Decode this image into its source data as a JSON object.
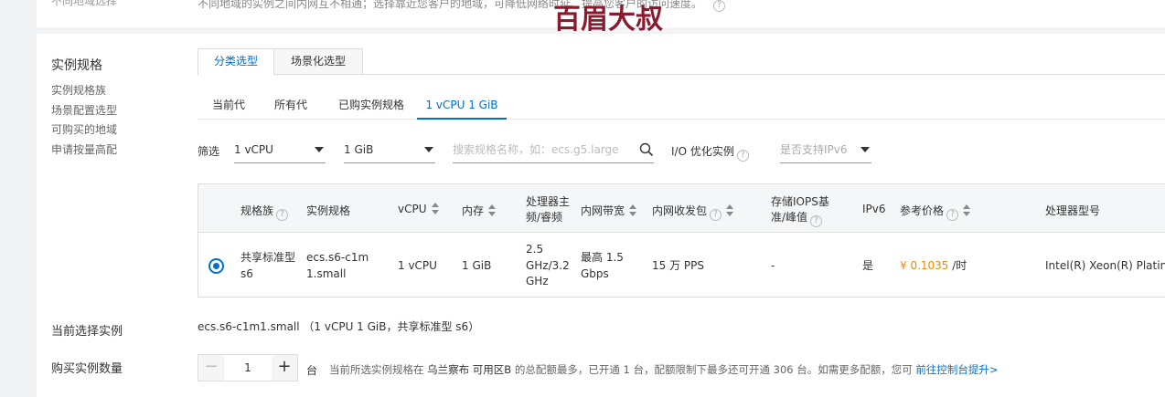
{
  "region": {
    "label": "不同地域选择",
    "note": "不同地域的实例之间内网互不相通；选择靠近您客户的地域，可降低网络时延、提高您客户的访问速度。"
  },
  "watermark": "百眉大叔",
  "sidebar": {
    "title": "实例规格",
    "links": [
      "实例规格族",
      "场景配置选型",
      "可购买的地域",
      "申请按量高配"
    ]
  },
  "tabs": [
    {
      "label": "分类选型",
      "active": true
    },
    {
      "label": "场景化选型",
      "active": false
    }
  ],
  "subtabs": [
    {
      "label": "当前代",
      "active": false
    },
    {
      "label": "所有代",
      "active": false
    },
    {
      "label": "已购实例规格",
      "active": false
    },
    {
      "label": "1 vCPU 1 GiB",
      "active": true
    }
  ],
  "filter": {
    "label": "筛选",
    "vcpu": "1 vCPU",
    "memory": "1 GiB",
    "search_placeholder": "搜索规格名称，如：ecs.g5.large",
    "io_label": "I/O 优化实例",
    "ipv6_placeholder": "是否支持IPv6"
  },
  "table": {
    "headers": {
      "family": "规格族",
      "spec": "实例规格",
      "vcpu": "vCPU",
      "memory": "内存",
      "freq": "处理器主频/睿频",
      "bandwidth": "内网带宽",
      "pps": "内网收发包",
      "iops": "存储IOPS基准/峰值",
      "ipv6": "IPv6",
      "price": "参考价格",
      "cpu_model": "处理器型号"
    },
    "row": {
      "family": "共享标准型 s6",
      "spec": "ecs.s6-c1m1.small",
      "vcpu": "1 vCPU",
      "memory": "1 GiB",
      "freq": "2.5 GHz/3.2 GHz",
      "bandwidth": "最高 1.5 Gbps",
      "pps": "15 万 PPS",
      "iops": "-",
      "ipv6": "是",
      "price": "¥ 0.1035",
      "price_unit": "/时",
      "cpu_model": "Intel(R) Xeon(R) Platinum"
    }
  },
  "current": {
    "label": "当前选择实例",
    "value": "ecs.s6-c1m1.small （1 vCPU 1 GiB，共享标准型 s6）"
  },
  "quantity": {
    "label": "购买实例数量",
    "minus": "−",
    "plus": "+",
    "value": "1",
    "unit": "台",
    "quota_prefix": "当前所选实例规格在",
    "quota_region": "乌兰察布 可用区B",
    "quota_mid": "的总配额最多，已开通 1 台，配额限制下最多还可开通 306 台。如需更多配额，您可",
    "quota_link": "前往控制台提升>"
  }
}
